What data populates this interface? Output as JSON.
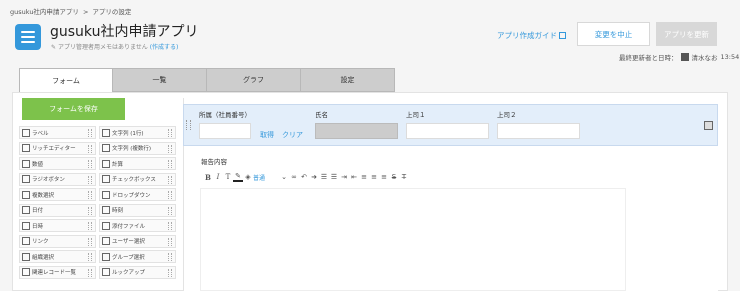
{
  "breadcrumb": [
    "gusuku社内申請アプリ",
    "アプリの設定"
  ],
  "breadcrumb_sep": ">",
  "app": {
    "title": "gusuku社内申請アプリ",
    "memo_text": "アプリ管理者用メモはありません",
    "memo_link": "(作成する)"
  },
  "header": {
    "guide_label": "アプリ作成ガイド",
    "cancel_label": "変更を中止",
    "update_label": "アプリを更新",
    "updated_label": "最終更新者と日時：",
    "updated_user": "清水なお",
    "updated_time": "13:54"
  },
  "tabs": [
    "フォーム",
    "一覧",
    "グラフ",
    "設定"
  ],
  "save_label": "フォームを保存",
  "palette": [
    [
      "ラベル",
      "文字列 (1行)"
    ],
    [
      "リッチエディター",
      "文字列 (複数行)"
    ],
    [
      "数値",
      "計算"
    ],
    [
      "ラジオボタン",
      "チェックボックス"
    ],
    [
      "複数選択",
      "ドロップダウン"
    ],
    [
      "日付",
      "時刻"
    ],
    [
      "日時",
      "添付ファイル"
    ],
    [
      "リンク",
      "ユーザー選択"
    ],
    [
      "組織選択",
      "グループ選択"
    ],
    [
      "関連レコード一覧",
      "ルックアップ"
    ]
  ],
  "fields": {
    "dept_label": "所属（社員番号）",
    "get_label": "取得",
    "clear_label": "クリア",
    "name_label": "氏名",
    "boss1_label": "上司１",
    "boss2_label": "上司２",
    "report_label": "報告内容"
  },
  "toolbar": {
    "font_label": "普通"
  },
  "colors": {
    "accent": "#3498db",
    "save": "#7dc24b",
    "row_highlight": "#e3eefa"
  }
}
